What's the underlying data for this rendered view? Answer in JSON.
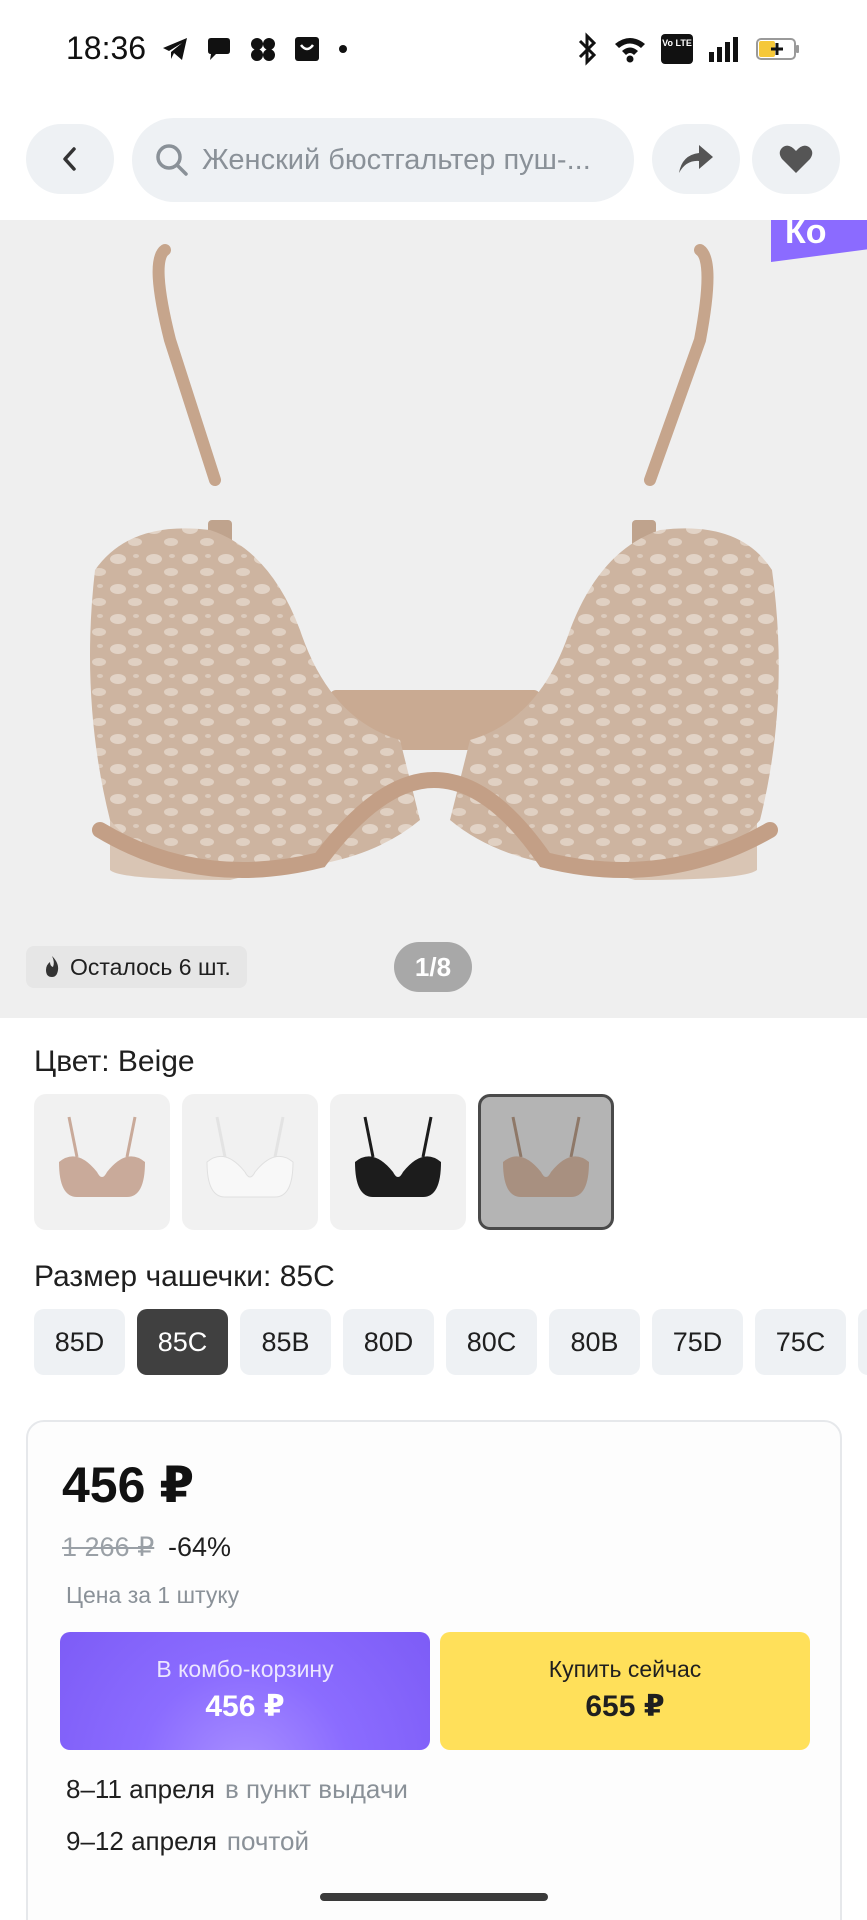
{
  "status_bar": {
    "time": "18:36",
    "app_icons": [
      "telegram-icon",
      "chat-icon",
      "app-icon",
      "shopping-bag-icon",
      "dot-icon"
    ],
    "system_icons": [
      "bluetooth-icon",
      "wifi-icon",
      "volte-icon",
      "signal-icon",
      "battery-icon"
    ],
    "volte_label": "Vo LTE"
  },
  "nav": {
    "search_text": "Женский бюстгальтер пуш-..."
  },
  "gallery": {
    "promo_flag_text": "Ко",
    "stock_text": "Осталось 6 шт.",
    "page_indicator": "1/8"
  },
  "color": {
    "label": "Цвет: Beige",
    "swatches": [
      {
        "name": "beige-lace",
        "color": "#c9aa9a"
      },
      {
        "name": "white",
        "color": "#eeeeee"
      },
      {
        "name": "black",
        "color": "#1c1c1c"
      },
      {
        "name": "beige-selected",
        "color": "#b49a84"
      }
    ],
    "selected_index": 3
  },
  "size": {
    "label": "Размер чашечки: 85C",
    "options": [
      "85D",
      "85C",
      "85B",
      "80D",
      "80C",
      "80B",
      "75D",
      "75C"
    ],
    "selected_index": 1
  },
  "price": {
    "current": "456 ₽",
    "old": "1 266 ₽",
    "discount": "-64%",
    "unit_note": "Цена за 1 штуку"
  },
  "buttons": {
    "combo_label": "В комбо-корзину",
    "combo_price": "456 ₽",
    "buy_label": "Купить сейчас",
    "buy_price": "655 ₽"
  },
  "delivery": [
    {
      "dates": "8–11 апреля",
      "method": "в пункт выдачи"
    },
    {
      "dates": "9–12 апреля",
      "method": "почтой"
    }
  ],
  "colors": {
    "accent_purple": "#8b6cff",
    "accent_yellow": "#ffe05a",
    "chip_bg": "#eef1f4",
    "selected_chip": "#404040"
  }
}
